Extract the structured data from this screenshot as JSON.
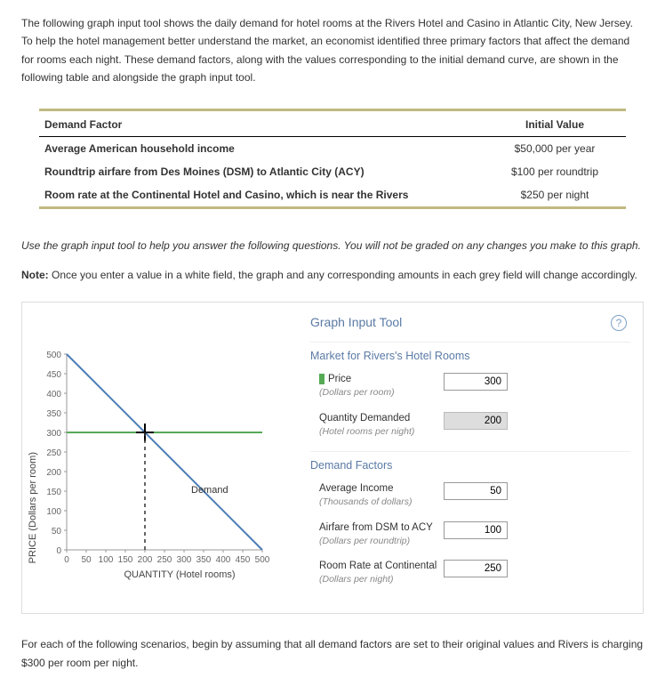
{
  "intro": "The following graph input tool shows the daily demand for hotel rooms at the Rivers Hotel and Casino in Atlantic City, New Jersey. To help the hotel management better understand the market, an economist identified three primary factors that affect the demand for rooms each night. These demand factors, along with the values corresponding to the initial demand curve, are shown in the following table and alongside the graph input tool.",
  "factor_table": {
    "head_factor": "Demand Factor",
    "head_value": "Initial Value",
    "rows": [
      {
        "factor": "Average American household income",
        "value": "$50,000 per year"
      },
      {
        "factor": "Roundtrip airfare from Des Moines (DSM) to Atlantic City (ACY)",
        "value": "$100 per roundtrip"
      },
      {
        "factor": "Room rate at the Continental Hotel and Casino, which is near the Rivers",
        "value": "$250 per night"
      }
    ]
  },
  "instruction": "Use the graph input tool to help you answer the following questions. You will not be graded on any changes you make to this graph.",
  "note_label": "Note:",
  "note_text": " Once you enter a value in a white field, the graph and any corresponding amounts in each grey field will change accordingly.",
  "tool": {
    "title": "Graph Input Tool",
    "help": "?",
    "section_market": "Market for Rivers's Hotel Rooms",
    "price_label": "Price",
    "price_sub": "(Dollars per room)",
    "price_value": "300",
    "qty_label": "Quantity Demanded",
    "qty_sub": "(Hotel rooms per night)",
    "qty_value": "200",
    "section_factors": "Demand Factors",
    "income_label": "Average Income",
    "income_sub": "(Thousands of dollars)",
    "income_value": "50",
    "airfare_label": "Airfare from DSM to ACY",
    "airfare_sub": "(Dollars per roundtrip)",
    "airfare_value": "100",
    "roomrate_label": "Room Rate at Continental",
    "roomrate_sub": "(Dollars per night)",
    "roomrate_value": "250"
  },
  "chart": {
    "y_label": "PRICE (Dollars per room)",
    "x_label": "QUANTITY (Hotel rooms)",
    "demand_label": "Demand",
    "ticks": [
      "0",
      "50",
      "100",
      "150",
      "200",
      "250",
      "300",
      "350",
      "400",
      "450",
      "500"
    ]
  },
  "chart_data": {
    "type": "line",
    "title": "Market for Rivers's Hotel Rooms",
    "xlabel": "QUANTITY (Hotel rooms)",
    "ylabel": "PRICE (Dollars per room)",
    "xlim": [
      0,
      500
    ],
    "ylim": [
      0,
      500
    ],
    "series": [
      {
        "name": "Demand",
        "x": [
          0,
          500
        ],
        "y": [
          500,
          0
        ],
        "color": "#4a7db8"
      },
      {
        "name": "Price line",
        "x": [
          0,
          500
        ],
        "y": [
          300,
          300
        ],
        "color": "#55aa55"
      }
    ],
    "marker": {
      "x": 200,
      "y": 300
    }
  },
  "outro": "For each of the following scenarios, begin by assuming that all demand factors are set to their original values and Rivers is charging $300 per room per night."
}
